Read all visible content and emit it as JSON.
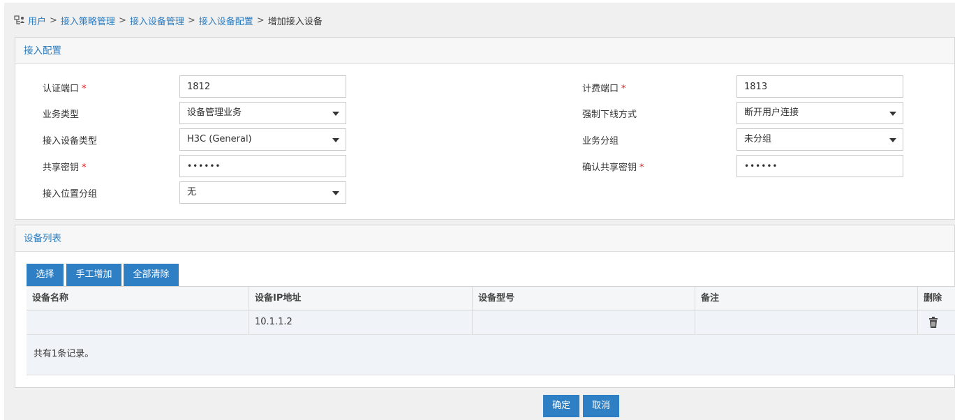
{
  "breadcrumb": {
    "items": [
      "用户",
      "接入策略管理",
      "接入设备管理",
      "接入设备配置"
    ],
    "current": "增加接入设备",
    "separator": ">"
  },
  "config_panel": {
    "title": "接入配置",
    "auth_port": {
      "label": "认证端口",
      "required": "*",
      "value": "1812"
    },
    "billing_port": {
      "label": "计费端口",
      "required": "*",
      "value": "1813"
    },
    "service_type": {
      "label": "业务类型",
      "value": "设备管理业务"
    },
    "force_offline": {
      "label": "强制下线方式",
      "value": "断开用户连接"
    },
    "device_type": {
      "label": "接入设备类型",
      "value": "H3C (General)"
    },
    "service_group": {
      "label": "业务分组",
      "value": "未分组"
    },
    "shared_key": {
      "label": "共享密钥",
      "required": "*",
      "value": "••••••"
    },
    "confirm_key": {
      "label": "确认共享密钥",
      "required": "*",
      "value": "••••••"
    },
    "location_group": {
      "label": "接入位置分组",
      "value": "无"
    }
  },
  "devices_panel": {
    "title": "设备列表",
    "buttons": {
      "select": "选择",
      "manual_add": "手工增加",
      "clear_all": "全部清除"
    },
    "columns": [
      "设备名称",
      "设备IP地址",
      "设备型号",
      "备注",
      "删除"
    ],
    "rows": [
      {
        "name": "",
        "ip": "10.1.1.2",
        "model": "",
        "note": ""
      }
    ],
    "summary": "共有1条记录。"
  },
  "footer": {
    "ok": "确定",
    "cancel": "取消"
  },
  "colors": {
    "accent": "#2e7fc4",
    "link": "#2b7bbf",
    "required": "#e02020"
  },
  "icons": {
    "breadcrumb": "user-tree-icon",
    "delete": "trash-icon",
    "dropdown": "caret-down-icon"
  }
}
